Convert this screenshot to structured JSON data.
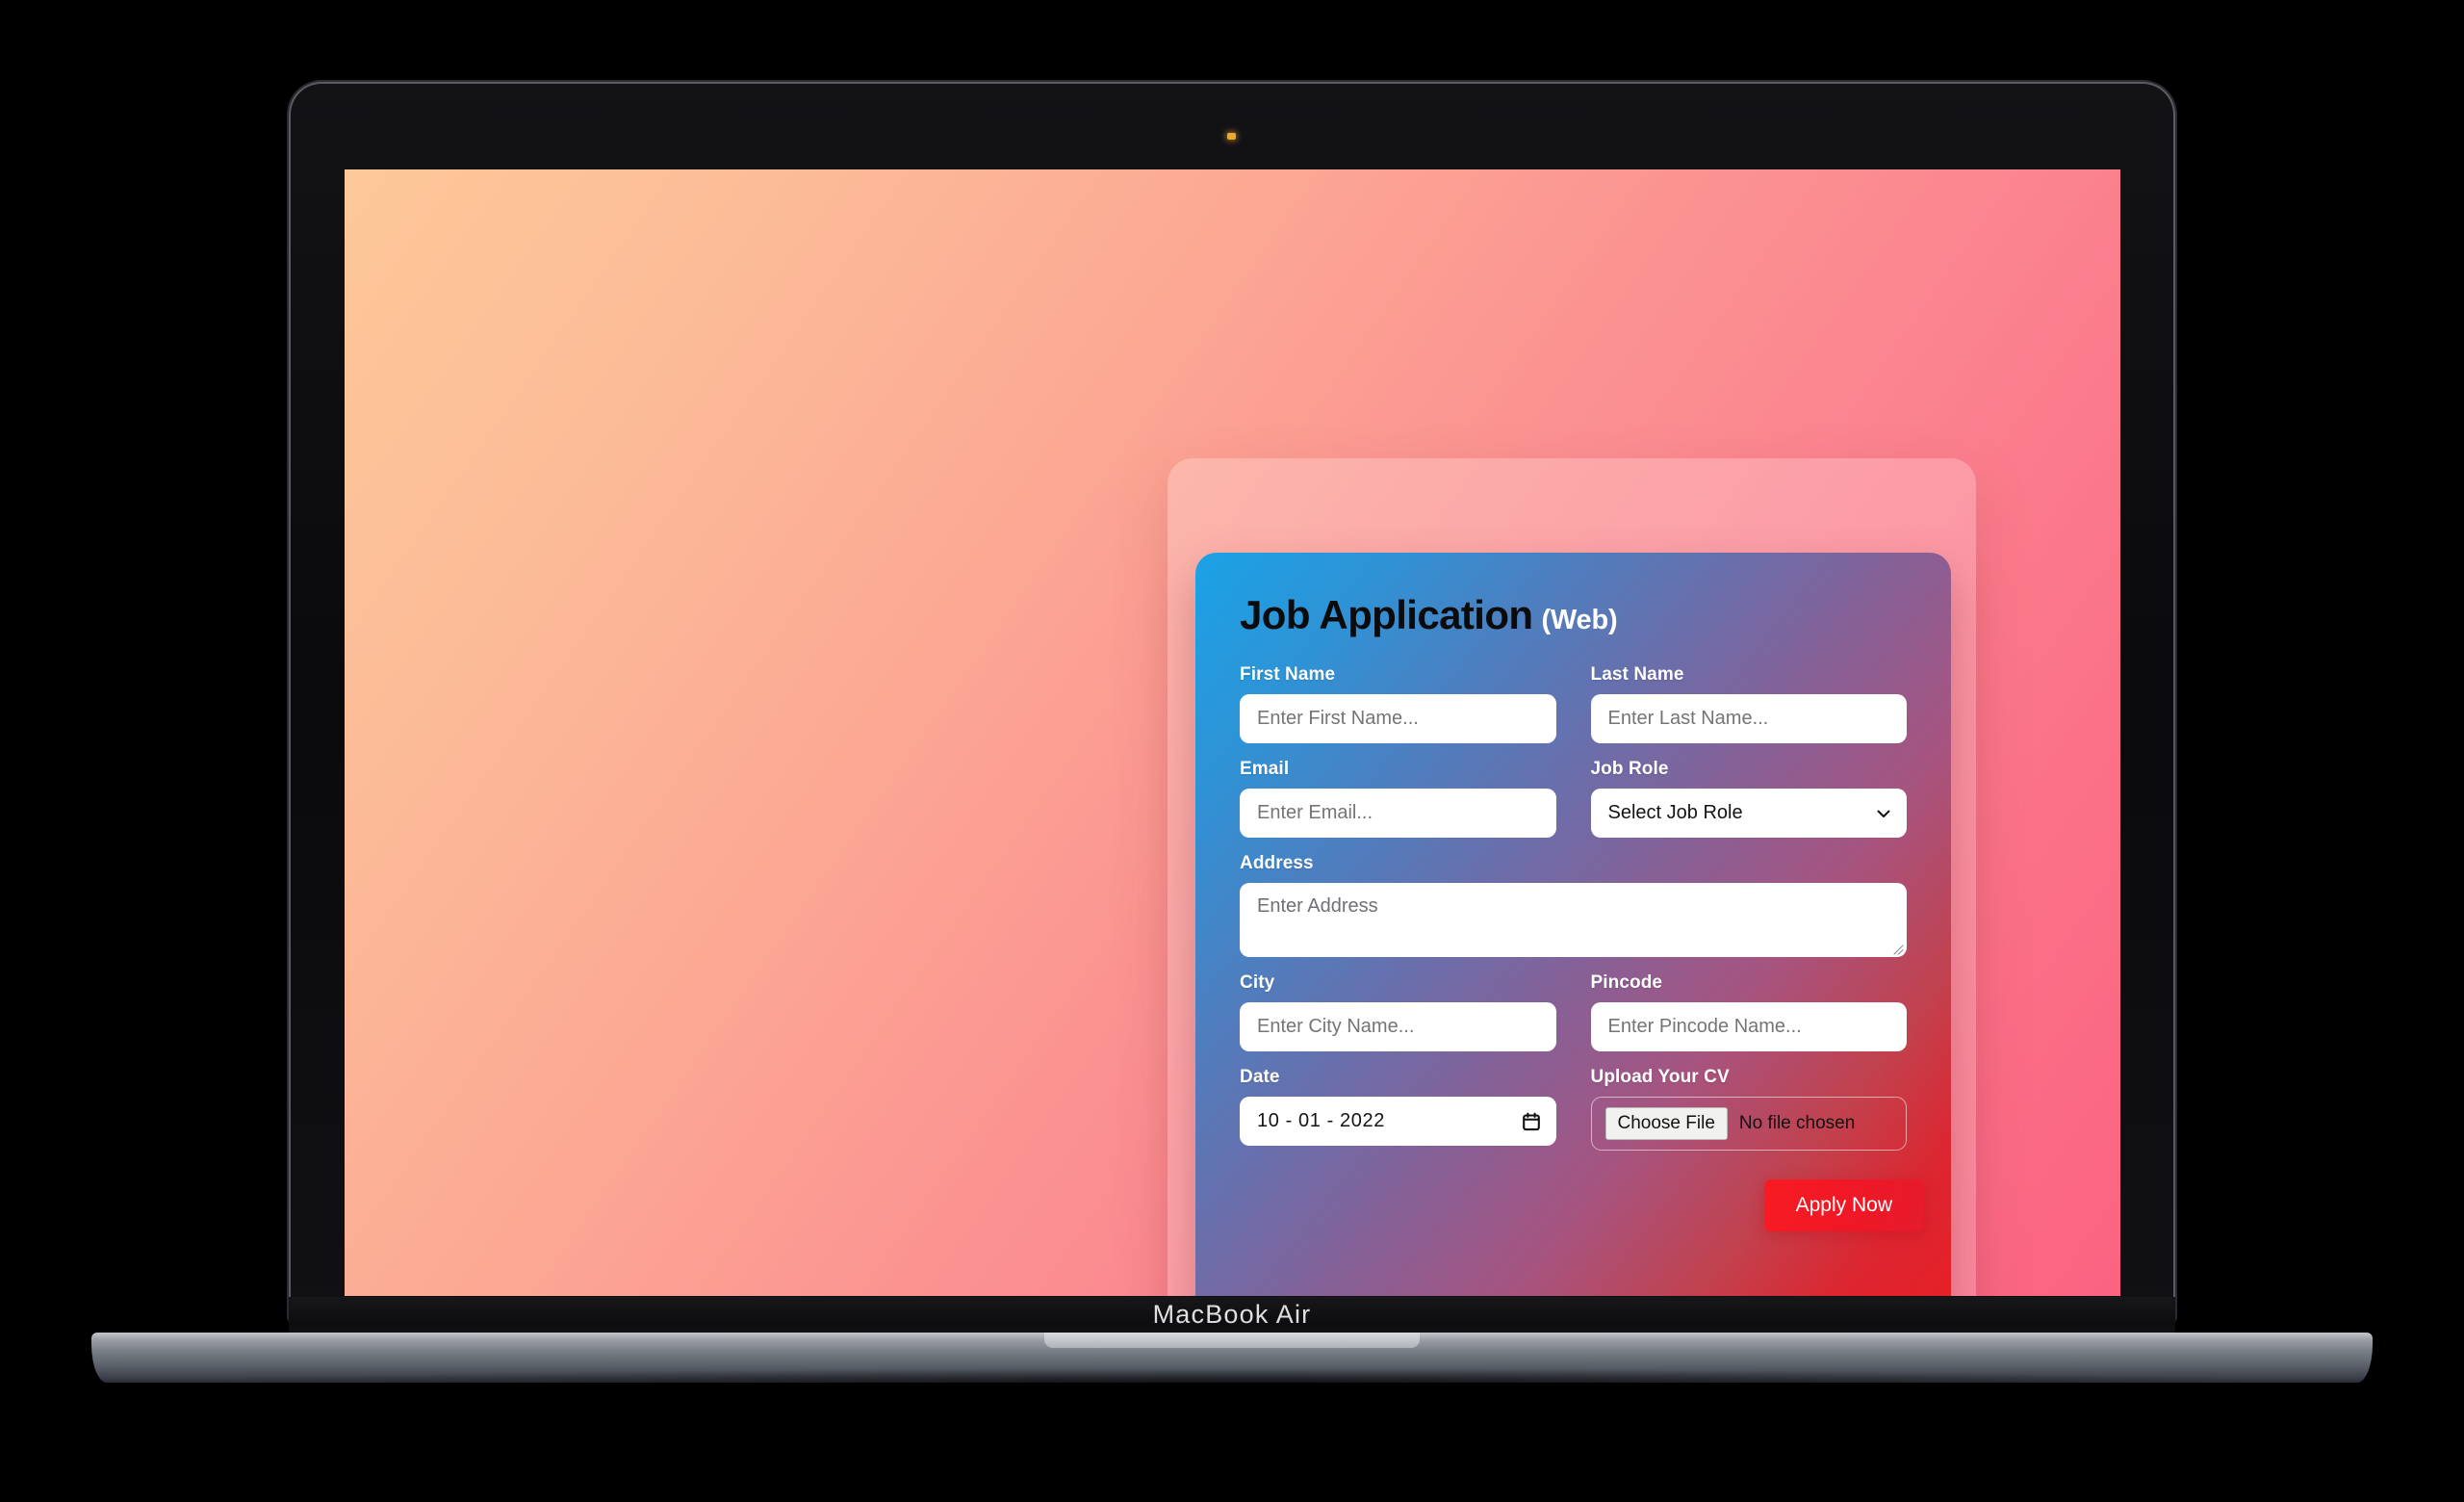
{
  "device": {
    "brand_label": "MacBook Air",
    "camera_indicator": "camera-indicator-dot"
  },
  "form": {
    "title_main": "Job Application",
    "title_sub": "(Web)",
    "fields": {
      "first_name": {
        "label": "First Name",
        "placeholder": "Enter First Name...",
        "value": ""
      },
      "last_name": {
        "label": "Last Name",
        "placeholder": "Enter Last Name...",
        "value": ""
      },
      "email": {
        "label": "Email",
        "placeholder": "Enter Email...",
        "value": ""
      },
      "job_role": {
        "label": "Job Role",
        "selected": "Select Job Role",
        "options": [
          "Select Job Role"
        ]
      },
      "address": {
        "label": "Address",
        "placeholder": "Enter Address",
        "value": ""
      },
      "city": {
        "label": "City",
        "placeholder": "Enter City Name...",
        "value": ""
      },
      "pincode": {
        "label": "Pincode",
        "placeholder": "Enter Pincode Name...",
        "value": ""
      },
      "date": {
        "label": "Date",
        "value": "10 - 01 - 2022"
      },
      "upload_cv": {
        "label": "Upload Your CV",
        "button_label": "Choose File",
        "status": "No file chosen"
      }
    },
    "submit": {
      "label": "Apply Now"
    }
  },
  "colors": {
    "wallpaper_start": "#fdc899",
    "wallpaper_end": "#fb6381",
    "form_gradient_start": "#1ba2e6",
    "form_gradient_end": "#e81f25",
    "submit_button": "#f81b21",
    "title_main_color": "#0b0b0c",
    "title_sub_color": "#ffffff",
    "label_color": "#ffffff",
    "input_background": "#ffffff",
    "camera_dot": "#f0a830"
  }
}
